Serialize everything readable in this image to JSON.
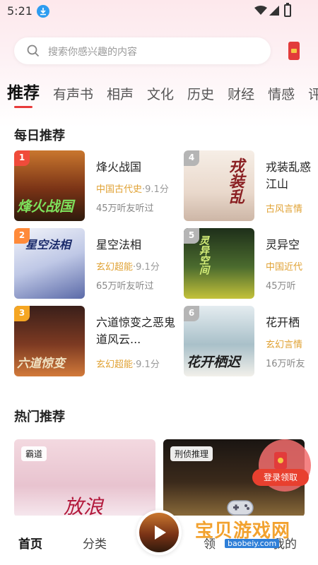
{
  "status_bar": {
    "time": "5:21"
  },
  "search": {
    "placeholder": "搜索你感兴趣的内容"
  },
  "tabs": [
    {
      "label": "推荐",
      "active": true
    },
    {
      "label": "有声书"
    },
    {
      "label": "相声"
    },
    {
      "label": "文化"
    },
    {
      "label": "历史"
    },
    {
      "label": "财经"
    },
    {
      "label": "情感"
    },
    {
      "label": "评"
    }
  ],
  "daily": {
    "title": "每日推荐",
    "books": [
      {
        "rank": "1",
        "title": "烽火战国",
        "category": "中国古代史",
        "rating": "·9.1分",
        "listens": "45万听友听过",
        "cover_text": "烽火战国"
      },
      {
        "rank": "2",
        "title": "星空法相",
        "category": "玄幻超能",
        "rating": "·9.1分",
        "listens": "65万听友听过",
        "cover_text": "星空法相"
      },
      {
        "rank": "3",
        "title": "六道惊变之恶鬼道风云...",
        "category": "玄幻超能",
        "rating": "·9.1分",
        "listens": "",
        "cover_text": "六道惊变"
      },
      {
        "rank": "4",
        "title": "戎装乱惑江山",
        "category": "古风言情",
        "rating": "",
        "listens": "",
        "cover_text": "戎装乱"
      },
      {
        "rank": "5",
        "title": "灵异空",
        "category": "中国近代",
        "rating": "",
        "listens": "45万听",
        "cover_text": "灵异空间"
      },
      {
        "rank": "6",
        "title": "花开栖",
        "category": "玄幻言情",
        "rating": "",
        "listens": "16万听友",
        "cover_text": "花开栖迟"
      }
    ]
  },
  "hot": {
    "title": "热门推荐",
    "cards": [
      {
        "tag": "霸道",
        "cover_text": "放浪"
      },
      {
        "tag": "刑侦推理"
      }
    ]
  },
  "login_promo": {
    "label": "登录领取"
  },
  "bottom_nav": {
    "items": [
      "首页",
      "分类",
      "领",
      "我的"
    ]
  },
  "watermark": {
    "text": "宝贝游戏网",
    "url": "baobeiy.com"
  },
  "colors": {
    "accent": "#e83a3a",
    "category": "#e0a234"
  }
}
